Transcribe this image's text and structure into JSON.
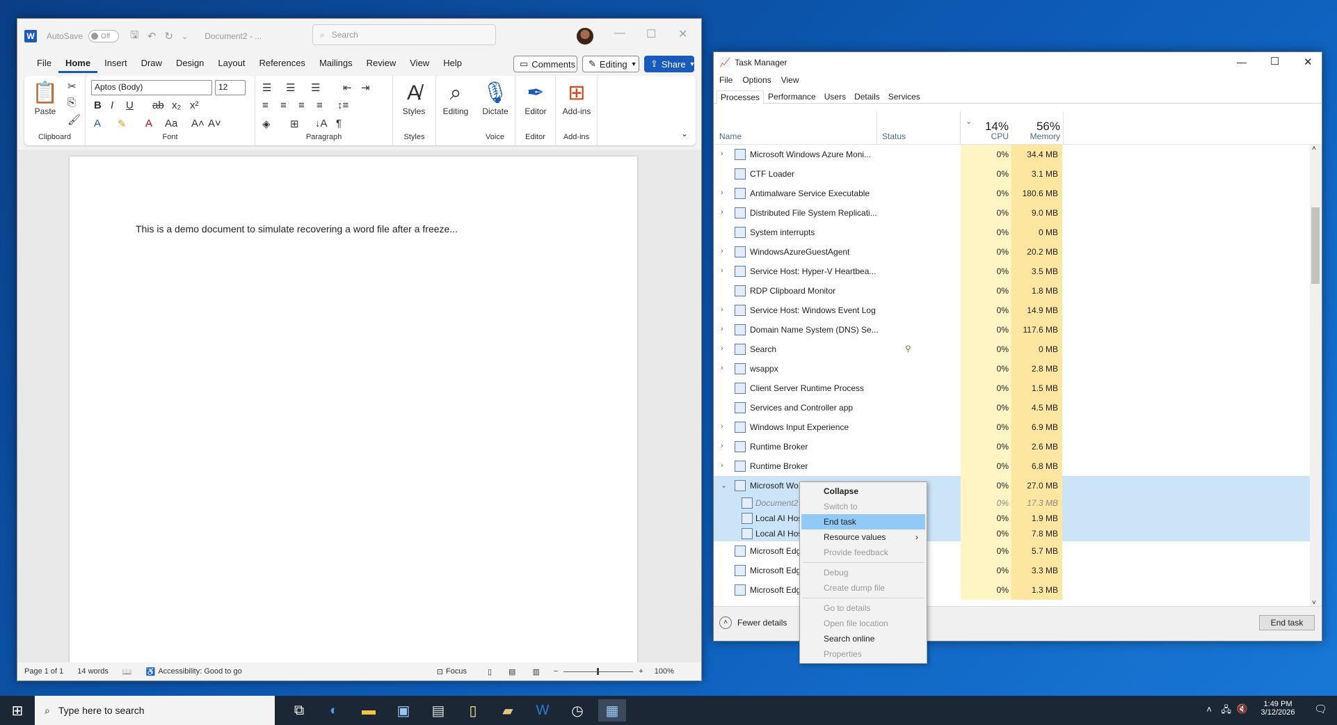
{
  "word": {
    "app_letter": "W",
    "autosave_label": "AutoSave",
    "autosave_state": "Off",
    "doc_title": "Document2 - ...",
    "search_placeholder": "Search",
    "menu_tabs": [
      "File",
      "Home",
      "Insert",
      "Draw",
      "Design",
      "Layout",
      "References",
      "Mailings",
      "Review",
      "View",
      "Help"
    ],
    "comments_label": "Comments",
    "editing_label": "Editing",
    "share_label": "Share",
    "ribbon": {
      "paste": "Paste",
      "clipboard": "Clipboard",
      "font_name": "Aptos (Body)",
      "font_size": "12",
      "font": "Font",
      "paragraph": "Paragraph",
      "styles_btn": "Styles",
      "styles_group": "Styles",
      "editing_btn": "Editing",
      "dictate": "Dictate",
      "voice": "Voice",
      "editor_btn": "Editor",
      "editor_group": "Editor",
      "addins_btn": "Add-ins",
      "addins_group": "Add-ins"
    },
    "doc_text": "This is a demo document to simulate recovering a word file after a freeze...",
    "status": {
      "page": "Page 1 of 1",
      "words": "14 words",
      "accessibility": "Accessibility: Good to go",
      "focus": "Focus",
      "zoom": "100%"
    }
  },
  "taskmgr": {
    "title": "Task Manager",
    "menu": [
      "File",
      "Options",
      "View"
    ],
    "tabs": [
      "Processes",
      "Performance",
      "Users",
      "Details",
      "Services"
    ],
    "headers": {
      "name": "Name",
      "status": "Status",
      "cpu_pct": "14%",
      "cpu": "CPU",
      "mem_pct": "56%",
      "mem": "Memory"
    },
    "rows": [
      {
        "name": "Microsoft Windows Azure Moni...",
        "cpu": "0%",
        "mem": "34.4 MB",
        "exp": true
      },
      {
        "name": "CTF Loader",
        "cpu": "0%",
        "mem": "3.1 MB",
        "exp": false
      },
      {
        "name": "Antimalware Service Executable",
        "cpu": "0%",
        "mem": "180.6 MB",
        "exp": true
      },
      {
        "name": "Distributed File System Replicati...",
        "cpu": "0%",
        "mem": "9.0 MB",
        "exp": true
      },
      {
        "name": "System interrupts",
        "cpu": "0%",
        "mem": "0 MB",
        "exp": false
      },
      {
        "name": "WindowsAzureGuestAgent",
        "cpu": "0%",
        "mem": "20.2 MB",
        "exp": true
      },
      {
        "name": "Service Host: Hyper-V Heartbea...",
        "cpu": "0%",
        "mem": "3.5 MB",
        "exp": true
      },
      {
        "name": "RDP Clipboard Monitor",
        "cpu": "0%",
        "mem": "1.8 MB",
        "exp": false
      },
      {
        "name": "Service Host: Windows Event Log",
        "cpu": "0%",
        "mem": "14.9 MB",
        "exp": true
      },
      {
        "name": "Domain Name System (DNS) Se...",
        "cpu": "0%",
        "mem": "117.6 MB",
        "exp": true
      },
      {
        "name": "Search",
        "cpu": "0%",
        "mem": "0 MB",
        "exp": true
      },
      {
        "name": "wsappx",
        "cpu": "0%",
        "mem": "2.8 MB",
        "exp": true
      },
      {
        "name": "Client Server Runtime Process",
        "cpu": "0%",
        "mem": "1.5 MB",
        "exp": false
      },
      {
        "name": "Services and Controller app",
        "cpu": "0%",
        "mem": "4.5 MB",
        "exp": false
      },
      {
        "name": "Windows Input Experience",
        "cpu": "0%",
        "mem": "6.9 MB",
        "exp": true
      },
      {
        "name": "Runtime Broker",
        "cpu": "0%",
        "mem": "2.6 MB",
        "exp": true
      },
      {
        "name": "Runtime Broker",
        "cpu": "0%",
        "mem": "6.8 MB",
        "exp": true
      },
      {
        "name": "Microsoft Wo...",
        "cpu": "0%",
        "mem": "27.0 MB",
        "exp": true
      }
    ],
    "subrows": [
      {
        "name": "Document2",
        "cpu": "0%",
        "mem": "17.3 MB"
      },
      {
        "name": "Local AI Hos",
        "cpu": "0%",
        "mem": "1.9 MB"
      },
      {
        "name": "Local AI Hos",
        "cpu": "0%",
        "mem": "7.8 MB"
      }
    ],
    "rows_after": [
      {
        "name": "Microsoft Edg",
        "cpu": "0%",
        "mem": "5.7 MB"
      },
      {
        "name": "Microsoft Edg",
        "cpu": "0%",
        "mem": "3.3 MB"
      },
      {
        "name": "Microsoft Edg",
        "cpu": "0%",
        "mem": "1.3 MB"
      }
    ],
    "fewer_details": "Fewer details",
    "end_task": "End task"
  },
  "context_menu": {
    "items": [
      {
        "label": "Collapse",
        "state": "bold"
      },
      {
        "label": "Switch to",
        "state": "disabled"
      },
      {
        "label": "End task",
        "state": "highlight"
      },
      {
        "label": "Resource values",
        "state": "submenu"
      },
      {
        "label": "Provide feedback",
        "state": "disabled"
      },
      {
        "sep": true
      },
      {
        "label": "Debug",
        "state": "disabled"
      },
      {
        "label": "Create dump file",
        "state": "disabled"
      },
      {
        "sep": true
      },
      {
        "label": "Go to details",
        "state": "disabled"
      },
      {
        "label": "Open file location",
        "state": "disabled"
      },
      {
        "label": "Search online",
        "state": "normal"
      },
      {
        "label": "Properties",
        "state": "disabled"
      }
    ]
  },
  "taskbar": {
    "search_placeholder": "Type here to search",
    "time": "1:49 PM",
    "date": "3/12/2026"
  }
}
